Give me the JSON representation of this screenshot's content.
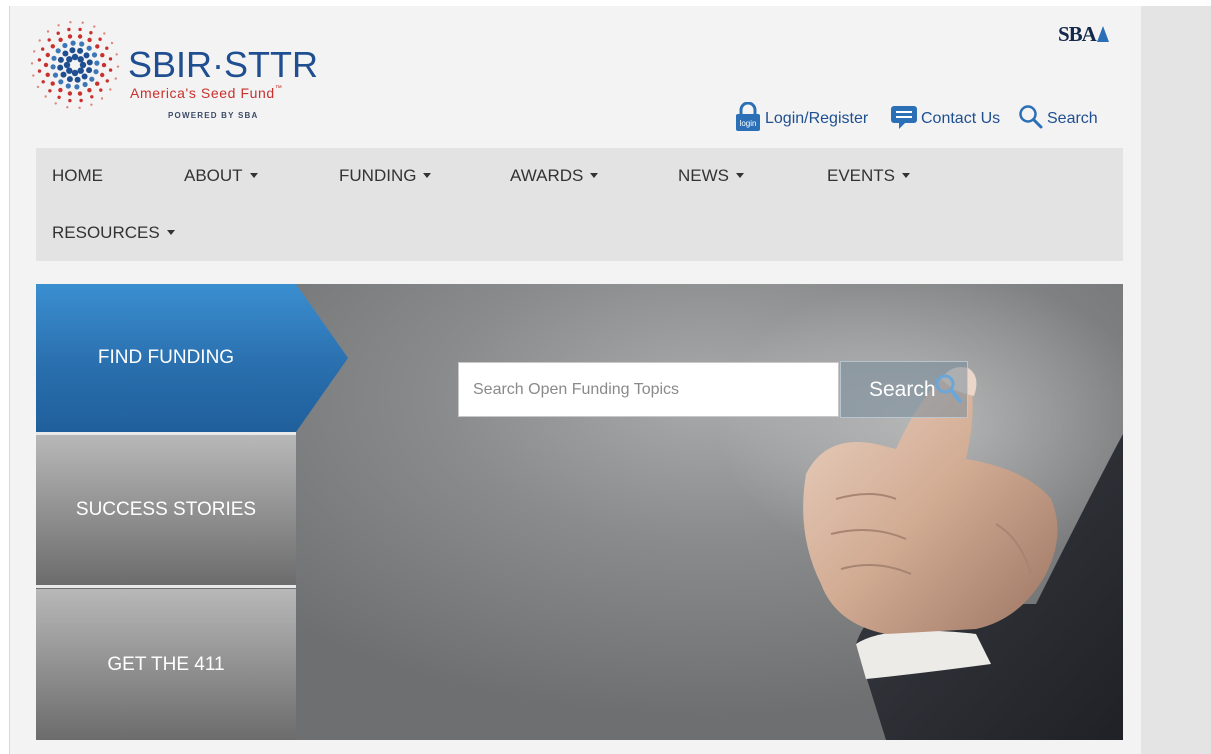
{
  "logo": {
    "title": "SBIR·STTR",
    "tagline": "America's Seed Fund",
    "trademark": "™",
    "powered_by": "POWERED BY SBA",
    "colors": {
      "blue": "#1f4f91",
      "red": "#c8312d"
    }
  },
  "agency_logo": {
    "text": "SBA"
  },
  "utility": {
    "login_icon_text": "login",
    "login_label": "Login/Register",
    "contact_label": "Contact Us",
    "search_label": "Search"
  },
  "nav": {
    "items": [
      {
        "label": "HOME",
        "dropdown": false
      },
      {
        "label": "ABOUT",
        "dropdown": true
      },
      {
        "label": "FUNDING",
        "dropdown": true
      },
      {
        "label": "AWARDS",
        "dropdown": true
      },
      {
        "label": "NEWS",
        "dropdown": true
      },
      {
        "label": "EVENTS",
        "dropdown": true
      },
      {
        "label": "RESOURCES",
        "dropdown": true
      }
    ]
  },
  "hero": {
    "tabs": [
      {
        "label": "FIND FUNDING",
        "active": true
      },
      {
        "label": "SUCCESS STORIES",
        "active": false
      },
      {
        "label": "GET THE 411",
        "active": false
      }
    ],
    "search": {
      "placeholder": "Search Open Funding Topics",
      "value": "",
      "button_label": "Search"
    }
  },
  "colors": {
    "accent": "#2a6fae",
    "nav_bg": "#e3e3e3",
    "page_bg": "#f3f3f3",
    "link": "#1f4f91"
  }
}
